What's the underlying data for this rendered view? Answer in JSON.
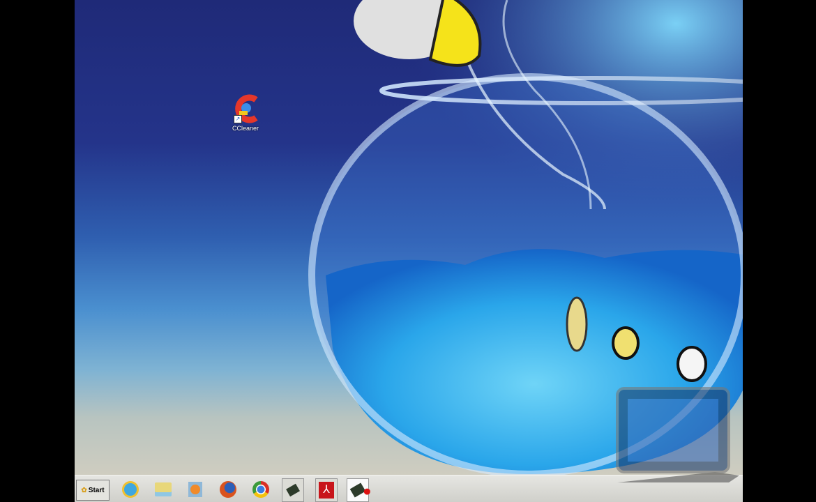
{
  "desktop": {
    "icons": [
      {
        "label": "CCleaner",
        "icon": "ccleaner-icon"
      }
    ]
  },
  "taskbar": {
    "start_label": "Start",
    "items": [
      {
        "name": "internet-explorer",
        "icon": "ie-icon",
        "color": "#3fa7e0"
      },
      {
        "name": "file-explorer",
        "icon": "folder-icon",
        "color": "#e8d77a"
      },
      {
        "name": "media-player",
        "icon": "media-player-icon",
        "color": "#f08a2a"
      },
      {
        "name": "firefox",
        "icon": "firefox-icon",
        "color": "#d9531e"
      },
      {
        "name": "chrome",
        "icon": "chrome-icon",
        "color": "#3b9a3b"
      },
      {
        "name": "app",
        "icon": "chip-icon",
        "color": "#2d3b2a"
      },
      {
        "name": "adobe-reader",
        "icon": "pdf-icon",
        "color": "#c8141a"
      },
      {
        "name": "app-active",
        "icon": "chip-record-icon",
        "color": "#2d3b2a"
      }
    ]
  }
}
